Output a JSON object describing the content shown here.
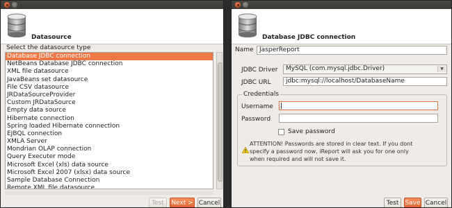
{
  "left_dialog": {
    "header_title": "Datasource",
    "caption": "Select the datasource type",
    "items": [
      "Database JDBC connection",
      "NetBeans Database JDBC connection",
      "XML file datasource",
      "JavaBeans set datasource",
      "File CSV datasource",
      "JRDataSourceProvider",
      "Custom JRDataSource",
      "Empty data source",
      "Hibernate connection",
      "Spring loaded Hibernate connection",
      "EJBQL connection",
      "XMLA Server",
      "Mondrian OLAP connection",
      "Query Executer mode",
      "Microsoft Excel (xls) data source",
      "Microsoft Excel 2007 (xlsx) data source",
      "Sample Database Connection",
      "Remote XML file datasource"
    ],
    "selected_index": 0,
    "buttons": {
      "test": "Test",
      "next": "Next >",
      "cancel": "Cancel"
    }
  },
  "right_dialog": {
    "header_title": "Database JDBC connection",
    "name_label": "Name",
    "name_value": "JasperReport",
    "driver_label": "JDBC Driver",
    "driver_value": "MySQL (com.mysql.jdbc.Driver)",
    "url_label": "JDBC URL",
    "url_value": "jdbc:mysql://localhost/DatabaseName",
    "credentials_title": "Credentials",
    "username_label": "Username",
    "username_value": "",
    "password_label": "Password",
    "password_value": "",
    "save_password_label": "Save password",
    "warning_line1": "ATTENTION! Passwords are stored in clear text. If you dont",
    "warning_line2": "specify a password now, iReport will ask you for one only",
    "warning_line3": "when required and will not save it.",
    "buttons": {
      "test": "Test",
      "save": "Save",
      "cancel": "Cancel"
    }
  },
  "colors": {
    "accent": "#f07846",
    "titlebar": "#3c3b37",
    "panel": "#efebe7"
  },
  "icons": [
    "close-icon",
    "minimize-icon",
    "database-icon",
    "warning-icon",
    "chevron-down-icon"
  ]
}
